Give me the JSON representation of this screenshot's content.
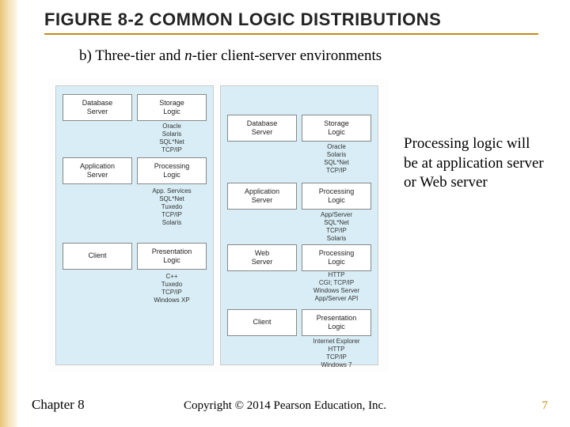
{
  "title": "FIGURE 8-2 COMMON LOGIC DISTRIBUTIONS",
  "subtitle_prefix": "b) Three-tier and ",
  "subtitle_italic": "n",
  "subtitle_suffix": "-tier client-server environments",
  "callout": "Processing logic will be at application server or Web server",
  "chapter": "Chapter 8",
  "copyright": "Copyright © 2014 Pearson Education, Inc.",
  "pagenum": "7",
  "left_panel": {
    "rows": [
      {
        "boxes": [
          "Database\nServer",
          "Storage\nLogic"
        ],
        "stack_r": "Oracle\nSolaris\nSQL*Net\nTCP/IP"
      },
      {
        "boxes": [
          "Application\nServer",
          "Processing\nLogic"
        ],
        "stack_r": "App. Services\nSQL*Net\nTuxedo\nTCP/IP\nSolaris"
      },
      {
        "boxes": [
          "Client",
          "Presentation\nLogic"
        ],
        "stack_r": "C++\nTuxedo\nTCP/IP\nWindows XP"
      }
    ]
  },
  "right_panel": {
    "rows": [
      {
        "boxes": [
          "Database\nServer",
          "Storage\nLogic"
        ],
        "stack_r": "Oracle\nSolaris\nSQL*Net\nTCP/IP",
        "side": "Oracle\nSolaris\nSQL*Net\nTCP/IP"
      },
      {
        "boxes": [
          "Application\nServer",
          "Processing\nLogic"
        ],
        "stack_r": "App/Server\nSQL*Net\nTCP/IP\nSolaris"
      },
      {
        "boxes": [
          "Web\nServer",
          "Processing\nLogic"
        ],
        "stack_r": "HTTP\nCGI; TCP/IP\nWindows Server\nApp/Server API"
      },
      {
        "boxes": [
          "Client",
          "Presentation\nLogic"
        ],
        "stack_r": "Internet Explorer\nHTTP\nTCP/IP\nWindows 7"
      }
    ]
  }
}
